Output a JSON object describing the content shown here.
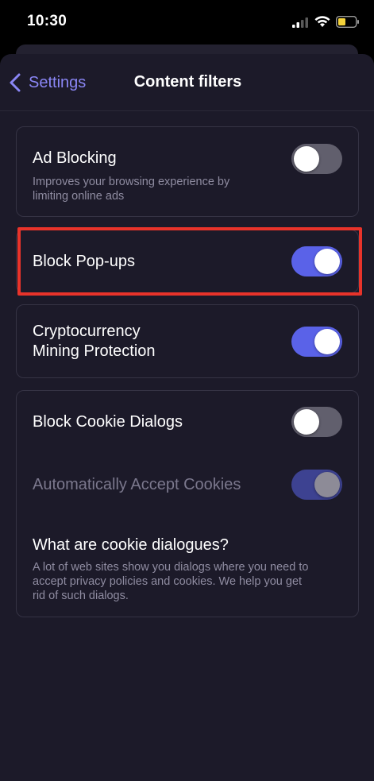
{
  "status_bar": {
    "time": "10:30",
    "icons": [
      "signal-icon",
      "wifi-icon",
      "battery-icon"
    ]
  },
  "nav": {
    "back_label": "Settings",
    "title": "Content filters"
  },
  "colors": {
    "accent": "#8a86f5",
    "toggle_on": "#5a62e8",
    "toggle_off": "#615f6d",
    "highlight": "#e8332a",
    "background": "#1c1a29"
  },
  "filters": {
    "ad_blocking": {
      "title": "Ad Blocking",
      "description_line1": "Improves your browsing experience by",
      "description_line2": "limiting online ads",
      "enabled": false
    },
    "block_popups": {
      "title": "Block Pop-ups",
      "enabled": true,
      "highlighted": true
    },
    "crypto_mining": {
      "title_line1": "Cryptocurrency",
      "title_line2": "Mining Protection",
      "enabled": true
    },
    "block_cookie_dialogs": {
      "title": "Block Cookie Dialogs",
      "enabled": false
    },
    "auto_accept_cookies": {
      "title": "Automatically Accept Cookies",
      "enabled": true,
      "disabled": true
    },
    "cookie_info": {
      "heading": "What are cookie dialogues?",
      "line1": "A lot of web sites show you dialogs where you need to",
      "line2": "accept privacy policies and cookies. We help you get",
      "line3": "rid of such dialogs."
    }
  }
}
